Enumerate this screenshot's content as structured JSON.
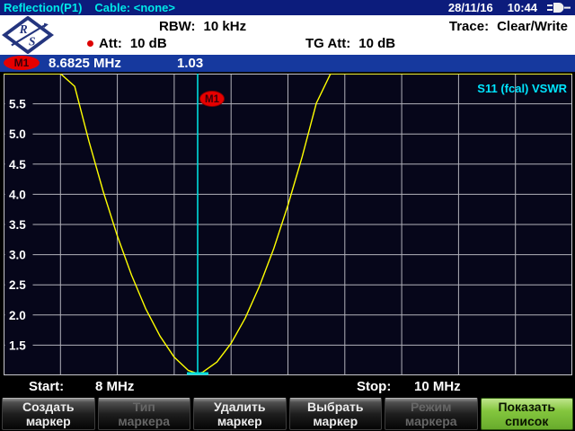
{
  "title_bar": {
    "title": "Reflection(P1)",
    "cable_label": "Cable: <none>",
    "date": "28/11/16",
    "time": "10:44",
    "power_icon": "ac-power-plug-icon"
  },
  "settings": {
    "logo": "rohde-schwarz-logo",
    "rbw_label": "RBW:",
    "rbw_value": "10 kHz",
    "trace_label": "Trace:",
    "trace_value": "Clear/Write",
    "att_label": "Att:",
    "att_value": "10 dB",
    "tg_att_label": "TG Att:",
    "tg_att_value": "10 dB"
  },
  "marker_bar": {
    "name": "M1",
    "frequency": "8.6825 MHz",
    "value": "1.03"
  },
  "chart_data": {
    "type": "line",
    "title": "S11 (fcal) VSWR",
    "x_start": 8,
    "x_stop": 10,
    "x_unit": "MHz",
    "ylim": [
      1.0,
      6.0
    ],
    "x_divisions": 10,
    "y_divisions": 10,
    "grid": true,
    "ytick_labels": [
      "5.5",
      "5.0",
      "4.5",
      "4.0",
      "3.5",
      "3.0",
      "2.5",
      "2.0",
      "1.5"
    ],
    "series": [
      {
        "name": "S11 (fcal) VSWR",
        "color": "#ffff00",
        "x": [
          8.0,
          8.05,
          8.1,
          8.15,
          8.2,
          8.25,
          8.3,
          8.35,
          8.4,
          8.45,
          8.5,
          8.55,
          8.6,
          8.65,
          8.6825,
          8.7,
          8.75,
          8.8,
          8.85,
          8.9,
          8.95,
          9.0,
          9.05,
          9.1,
          9.15,
          9.25,
          9.4,
          9.55,
          9.7,
          9.85,
          10.0
        ],
        "y": [
          6.0,
          6.0,
          6.0,
          6.0,
          6.0,
          5.79,
          4.88,
          4.05,
          3.31,
          2.66,
          2.1,
          1.65,
          1.3,
          1.08,
          1.03,
          1.05,
          1.22,
          1.53,
          1.95,
          2.48,
          3.1,
          3.82,
          4.62,
          5.51,
          6.0,
          6.0,
          6.0,
          6.0,
          6.0,
          6.0,
          6.0
        ]
      }
    ],
    "marker": {
      "name": "M1",
      "frequency_mhz": 8.6825,
      "vswr": 1.03
    }
  },
  "footer": {
    "start_label": "Start:",
    "start_value": "8 MHz",
    "stop_label": "Stop:",
    "stop_value": "10 MHz"
  },
  "softkeys": [
    {
      "name": "new-marker",
      "label_line1": "Создать",
      "label_line2": "маркер",
      "state": "enabled"
    },
    {
      "name": "marker-type",
      "label_line1": "Тип",
      "label_line2": "маркера",
      "state": "disabled"
    },
    {
      "name": "delete-marker",
      "label_line1": "Удалить",
      "label_line2": "маркер",
      "state": "enabled"
    },
    {
      "name": "select-marker",
      "label_line1": "Выбрать",
      "label_line2": "маркер",
      "state": "enabled"
    },
    {
      "name": "marker-mode",
      "label_line1": "Режим",
      "label_line2": "маркера",
      "state": "disabled"
    },
    {
      "name": "show-list",
      "label_line1": "Показать",
      "label_line2": "список",
      "state": "selected"
    }
  ],
  "colors": {
    "title_bar_bg": "#0c1c7c",
    "title_text_cyan": "#00e8e8",
    "header_bg": "#ffffff",
    "marker_bar_bg": "#16399e",
    "marker_red": "#e60000",
    "marker_text_dark": "#38000a",
    "chart_bg": "#06061a",
    "grid_line": "#b2b2ba",
    "chart_border": "#c8c8cc",
    "trace_yellow": "#ffff00",
    "marker_cyan": "#00dcdc",
    "chart_title_cyan": "#00e5ff",
    "softkey_green": "#7dc23e",
    "status_red_dot": "#dd0000",
    "logo_navy": "#24357e"
  }
}
